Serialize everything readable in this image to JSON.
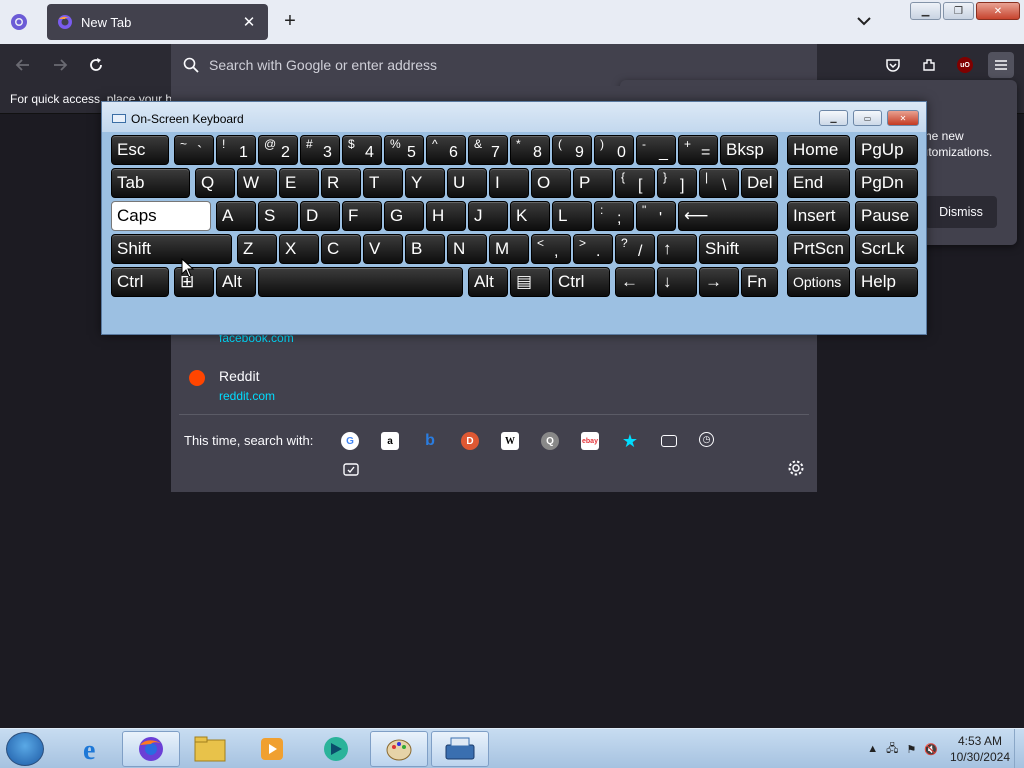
{
  "browser": {
    "tab": {
      "title": "New Tab"
    },
    "new_tab_label": "+",
    "url_placeholder": "Search with Google or enter address",
    "bookmarks_hint": "For quick access, place your bookmarks here on the bookmarks toolbar."
  },
  "notification": {
    "line1": "he new",
    "line2": "ıtomizations.",
    "dismiss_label": "Dismiss"
  },
  "dropdown": {
    "results": [
      {
        "title": "",
        "url": "facebook.com"
      },
      {
        "title": "Reddit",
        "url": "reddit.com"
      }
    ],
    "search_with_label": "This time, search with:",
    "engines": [
      "Google",
      "Amazon",
      "Bing",
      "DuckDuckGo",
      "Wikipedia",
      "Search",
      "eBay",
      "Bookmarks",
      "Tabs",
      "History",
      "Actions"
    ]
  },
  "osk": {
    "title": "On-Screen Keyboard",
    "rows": [
      [
        {
          "label": "Esc"
        },
        {
          "top": "~",
          "bot": "`"
        },
        {
          "top": "!",
          "bot": "1"
        },
        {
          "top": "@",
          "bot": "2"
        },
        {
          "top": "#",
          "bot": "3"
        },
        {
          "top": "$",
          "bot": "4"
        },
        {
          "top": "%",
          "bot": "5"
        },
        {
          "top": "^",
          "bot": "6"
        },
        {
          "top": "&",
          "bot": "7"
        },
        {
          "top": "*",
          "bot": "8"
        },
        {
          "top": "(",
          "bot": "9"
        },
        {
          "top": ")",
          "bot": "0"
        },
        {
          "top": "-",
          "bot": "_"
        },
        {
          "top": "+",
          "bot": "="
        },
        {
          "label": "Bksp"
        },
        {
          "label": "Home"
        },
        {
          "label": "PgUp"
        }
      ],
      [
        {
          "label": "Tab"
        },
        {
          "label": "Q"
        },
        {
          "label": "W"
        },
        {
          "label": "E"
        },
        {
          "label": "R"
        },
        {
          "label": "T"
        },
        {
          "label": "Y"
        },
        {
          "label": "U"
        },
        {
          "label": "I"
        },
        {
          "label": "O"
        },
        {
          "label": "P"
        },
        {
          "top": "{",
          "bot": "["
        },
        {
          "top": "}",
          "bot": "]"
        },
        {
          "top": "|",
          "bot": "\\"
        },
        {
          "label": "Del"
        },
        {
          "label": "End"
        },
        {
          "label": "PgDn"
        }
      ],
      [
        {
          "label": "Caps"
        },
        {
          "label": "A"
        },
        {
          "label": "S"
        },
        {
          "label": "D"
        },
        {
          "label": "F"
        },
        {
          "label": "G"
        },
        {
          "label": "H"
        },
        {
          "label": "J"
        },
        {
          "label": "K"
        },
        {
          "label": "L"
        },
        {
          "top": ":",
          "bot": ";"
        },
        {
          "top": "\"",
          "bot": "'"
        },
        {
          "label": "⟵"
        },
        {
          "label": "Insert"
        },
        {
          "label": "Pause"
        }
      ],
      [
        {
          "label": "Shift"
        },
        {
          "label": "Z"
        },
        {
          "label": "X"
        },
        {
          "label": "C"
        },
        {
          "label": "V"
        },
        {
          "label": "B"
        },
        {
          "label": "N"
        },
        {
          "label": "M"
        },
        {
          "top": "<",
          "bot": ","
        },
        {
          "top": ">",
          "bot": "."
        },
        {
          "top": "?",
          "bot": "/"
        },
        {
          "label": "↑"
        },
        {
          "label": "Shift"
        },
        {
          "label": "PrtScn"
        },
        {
          "label": "ScrLk"
        }
      ],
      [
        {
          "label": "Ctrl"
        },
        {
          "label": "⊞"
        },
        {
          "label": "Alt"
        },
        {
          "label": ""
        },
        {
          "label": "Alt"
        },
        {
          "label": "▤"
        },
        {
          "label": "Ctrl"
        },
        {
          "label": "←"
        },
        {
          "label": "↓"
        },
        {
          "label": "→"
        },
        {
          "label": "Fn"
        },
        {
          "label": "Options"
        },
        {
          "label": "Help"
        }
      ]
    ]
  },
  "taskbar": {
    "time": "4:53 AM",
    "date": "10/30/2024",
    "apps": [
      "Internet Explorer",
      "Firefox",
      "File Explorer",
      "Media Player",
      "App",
      "Paint",
      "On-Screen Keyboard"
    ]
  }
}
